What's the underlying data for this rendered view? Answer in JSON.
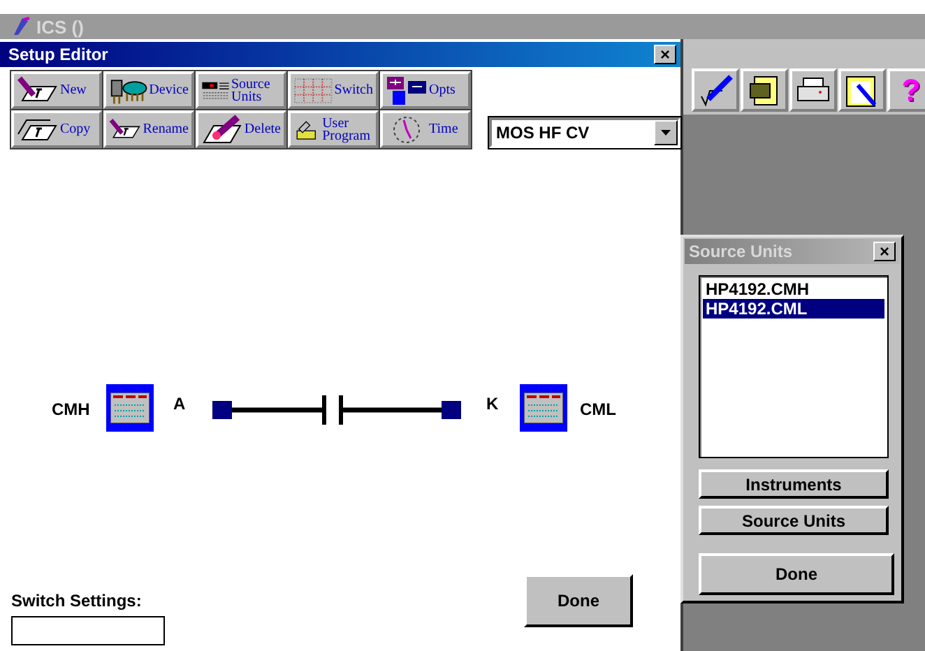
{
  "app": {
    "title": "ICS ()"
  },
  "editor": {
    "title": "Setup Editor",
    "close": "×",
    "toolbar": [
      {
        "kind": "new",
        "label": "New"
      },
      {
        "kind": "device",
        "label": "Device"
      },
      {
        "kind": "source",
        "label": "Source Units"
      },
      {
        "kind": "switch",
        "label": "Switch"
      },
      {
        "kind": "opts",
        "label": "Opts"
      },
      {
        "kind": "copy",
        "label": "Copy"
      },
      {
        "kind": "rename",
        "label": "Rename"
      },
      {
        "kind": "delete",
        "label": "Delete"
      },
      {
        "kind": "program",
        "label": "User Program"
      },
      {
        "kind": "time",
        "label": "Time"
      }
    ],
    "test_type": "MOS HF CV",
    "terminals": [
      {
        "source": "CMH",
        "pin": "A"
      },
      {
        "source": "CML",
        "pin": "K"
      }
    ],
    "switch_settings": {
      "label": "Switch Settings:"
    },
    "done": "Done"
  },
  "side_toolbar": [
    {
      "kind": "formula"
    },
    {
      "kind": "cabinet"
    },
    {
      "kind": "printer"
    },
    {
      "kind": "clipboard"
    },
    {
      "kind": "help",
      "glyph": "?"
    }
  ],
  "source_units": {
    "title": "Source Units",
    "close": "×",
    "items": [
      {
        "label": "HP4192.CMH",
        "selected": false
      },
      {
        "label": "HP4192.CML",
        "selected": true
      }
    ],
    "buttons": [
      "Instruments",
      "Source Units"
    ],
    "done": "Done"
  }
}
